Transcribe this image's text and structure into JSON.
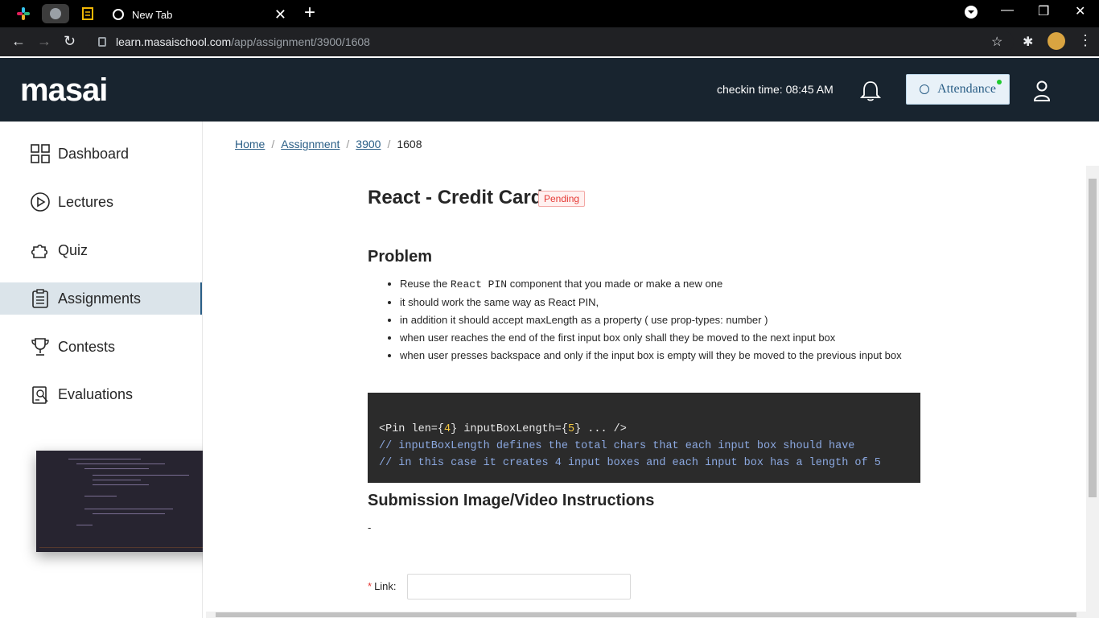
{
  "browser": {
    "tab_title": "New Tab",
    "url_host": "learn.masaischool.com",
    "url_path": "/app/assignment/3900/1608"
  },
  "header": {
    "logo_text": "masai",
    "checkin": "checkin time: 08:45 AM",
    "attendance_label": "Attendance"
  },
  "sidebar": {
    "items": [
      {
        "label": "Dashboard",
        "icon": "grid-icon"
      },
      {
        "label": "Lectures",
        "icon": "play-circle-icon"
      },
      {
        "label": "Quiz",
        "icon": "puzzle-icon"
      },
      {
        "label": "Assignments",
        "icon": "clipboard-icon",
        "active": true
      },
      {
        "label": "Contests",
        "icon": "trophy-icon"
      },
      {
        "label": "Evaluations",
        "icon": "evaluation-icon"
      }
    ]
  },
  "breadcrumb": {
    "home": "Home",
    "assignment": "Assignment",
    "id": "3900",
    "current": "1608"
  },
  "assignment": {
    "title": "React - Credit Card",
    "status": "Pending",
    "problem_heading": "Problem",
    "bullets": [
      {
        "pre": "Reuse the ",
        "code": "React PIN",
        "post": " component that you made or make a new one"
      },
      {
        "text": "it should work the same way as React PIN,"
      },
      {
        "text": "in addition it should accept maxLength as a property ( use prop-types: number )"
      },
      {
        "text": "when user reaches the end of the first input box only shall they be moved to the next input box"
      },
      {
        "text": "when user presses backspace and only if the input box is empty will they be moved to the previous input box"
      }
    ],
    "code_line1_a": "<Pin len={",
    "code_line1_n1": "4",
    "code_line1_b": "} inputBoxLength={",
    "code_line1_n2": "5",
    "code_line1_c": "} ... />",
    "code_comment1": "// inputBoxLength defines the total chars that each input box should have",
    "code_comment2": "// in this case it creates 4 input boxes and each input box has a length of 5",
    "submission_heading": "Submission Image/Video Instructions",
    "submission_text": "-",
    "link_label": "Link",
    "link_required_mark": "*",
    "link_colon": ":"
  },
  "colors": {
    "header_bg": "#18242f",
    "accent": "#2a5e86",
    "pending": "#e53935"
  }
}
